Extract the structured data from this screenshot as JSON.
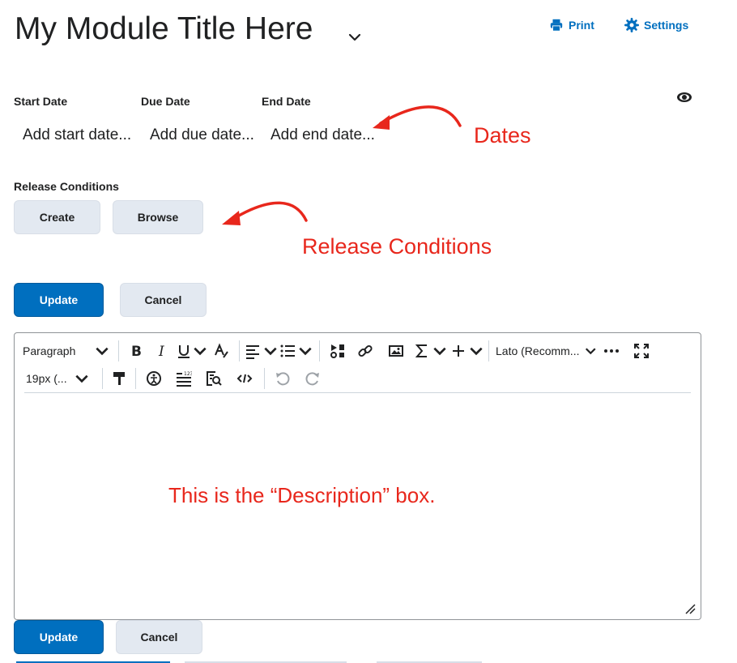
{
  "header": {
    "title": "My Module Title Here",
    "print_label": "Print",
    "settings_label": "Settings"
  },
  "dates": {
    "start_label": "Start Date",
    "start_placeholder": "Add start date...",
    "due_label": "Due Date",
    "due_placeholder": "Add due date...",
    "end_label": "End Date",
    "end_placeholder": "Add end date..."
  },
  "release": {
    "label": "Release Conditions",
    "create_label": "Create",
    "browse_label": "Browse"
  },
  "actions": {
    "update_label": "Update",
    "cancel_label": "Cancel"
  },
  "editor": {
    "block_format": "Paragraph",
    "font_family": "Lato (Recomm...",
    "font_size": "19px (...",
    "annotation_text": "This is the “Description” box."
  },
  "annotations": {
    "dates": "Dates",
    "release_conditions": "Release Conditions"
  },
  "colors": {
    "primary": "#006fbf",
    "secondary_button": "#e3e9f1",
    "annotation_red": "#e8271c"
  },
  "icons": [
    "chevron-down-icon",
    "printer-icon",
    "gear-icon",
    "eye-icon",
    "bold-icon",
    "italic-icon",
    "underline-icon",
    "text-color-icon",
    "align-icon",
    "list-icon",
    "insert-stuff-icon",
    "link-icon",
    "image-icon",
    "equation-icon",
    "plus-icon",
    "more-icon",
    "fullscreen-icon",
    "format-painter-icon",
    "accessibility-icon",
    "word-count-icon",
    "find-replace-icon",
    "source-code-icon",
    "undo-icon",
    "redo-icon",
    "resize-handle-icon"
  ]
}
